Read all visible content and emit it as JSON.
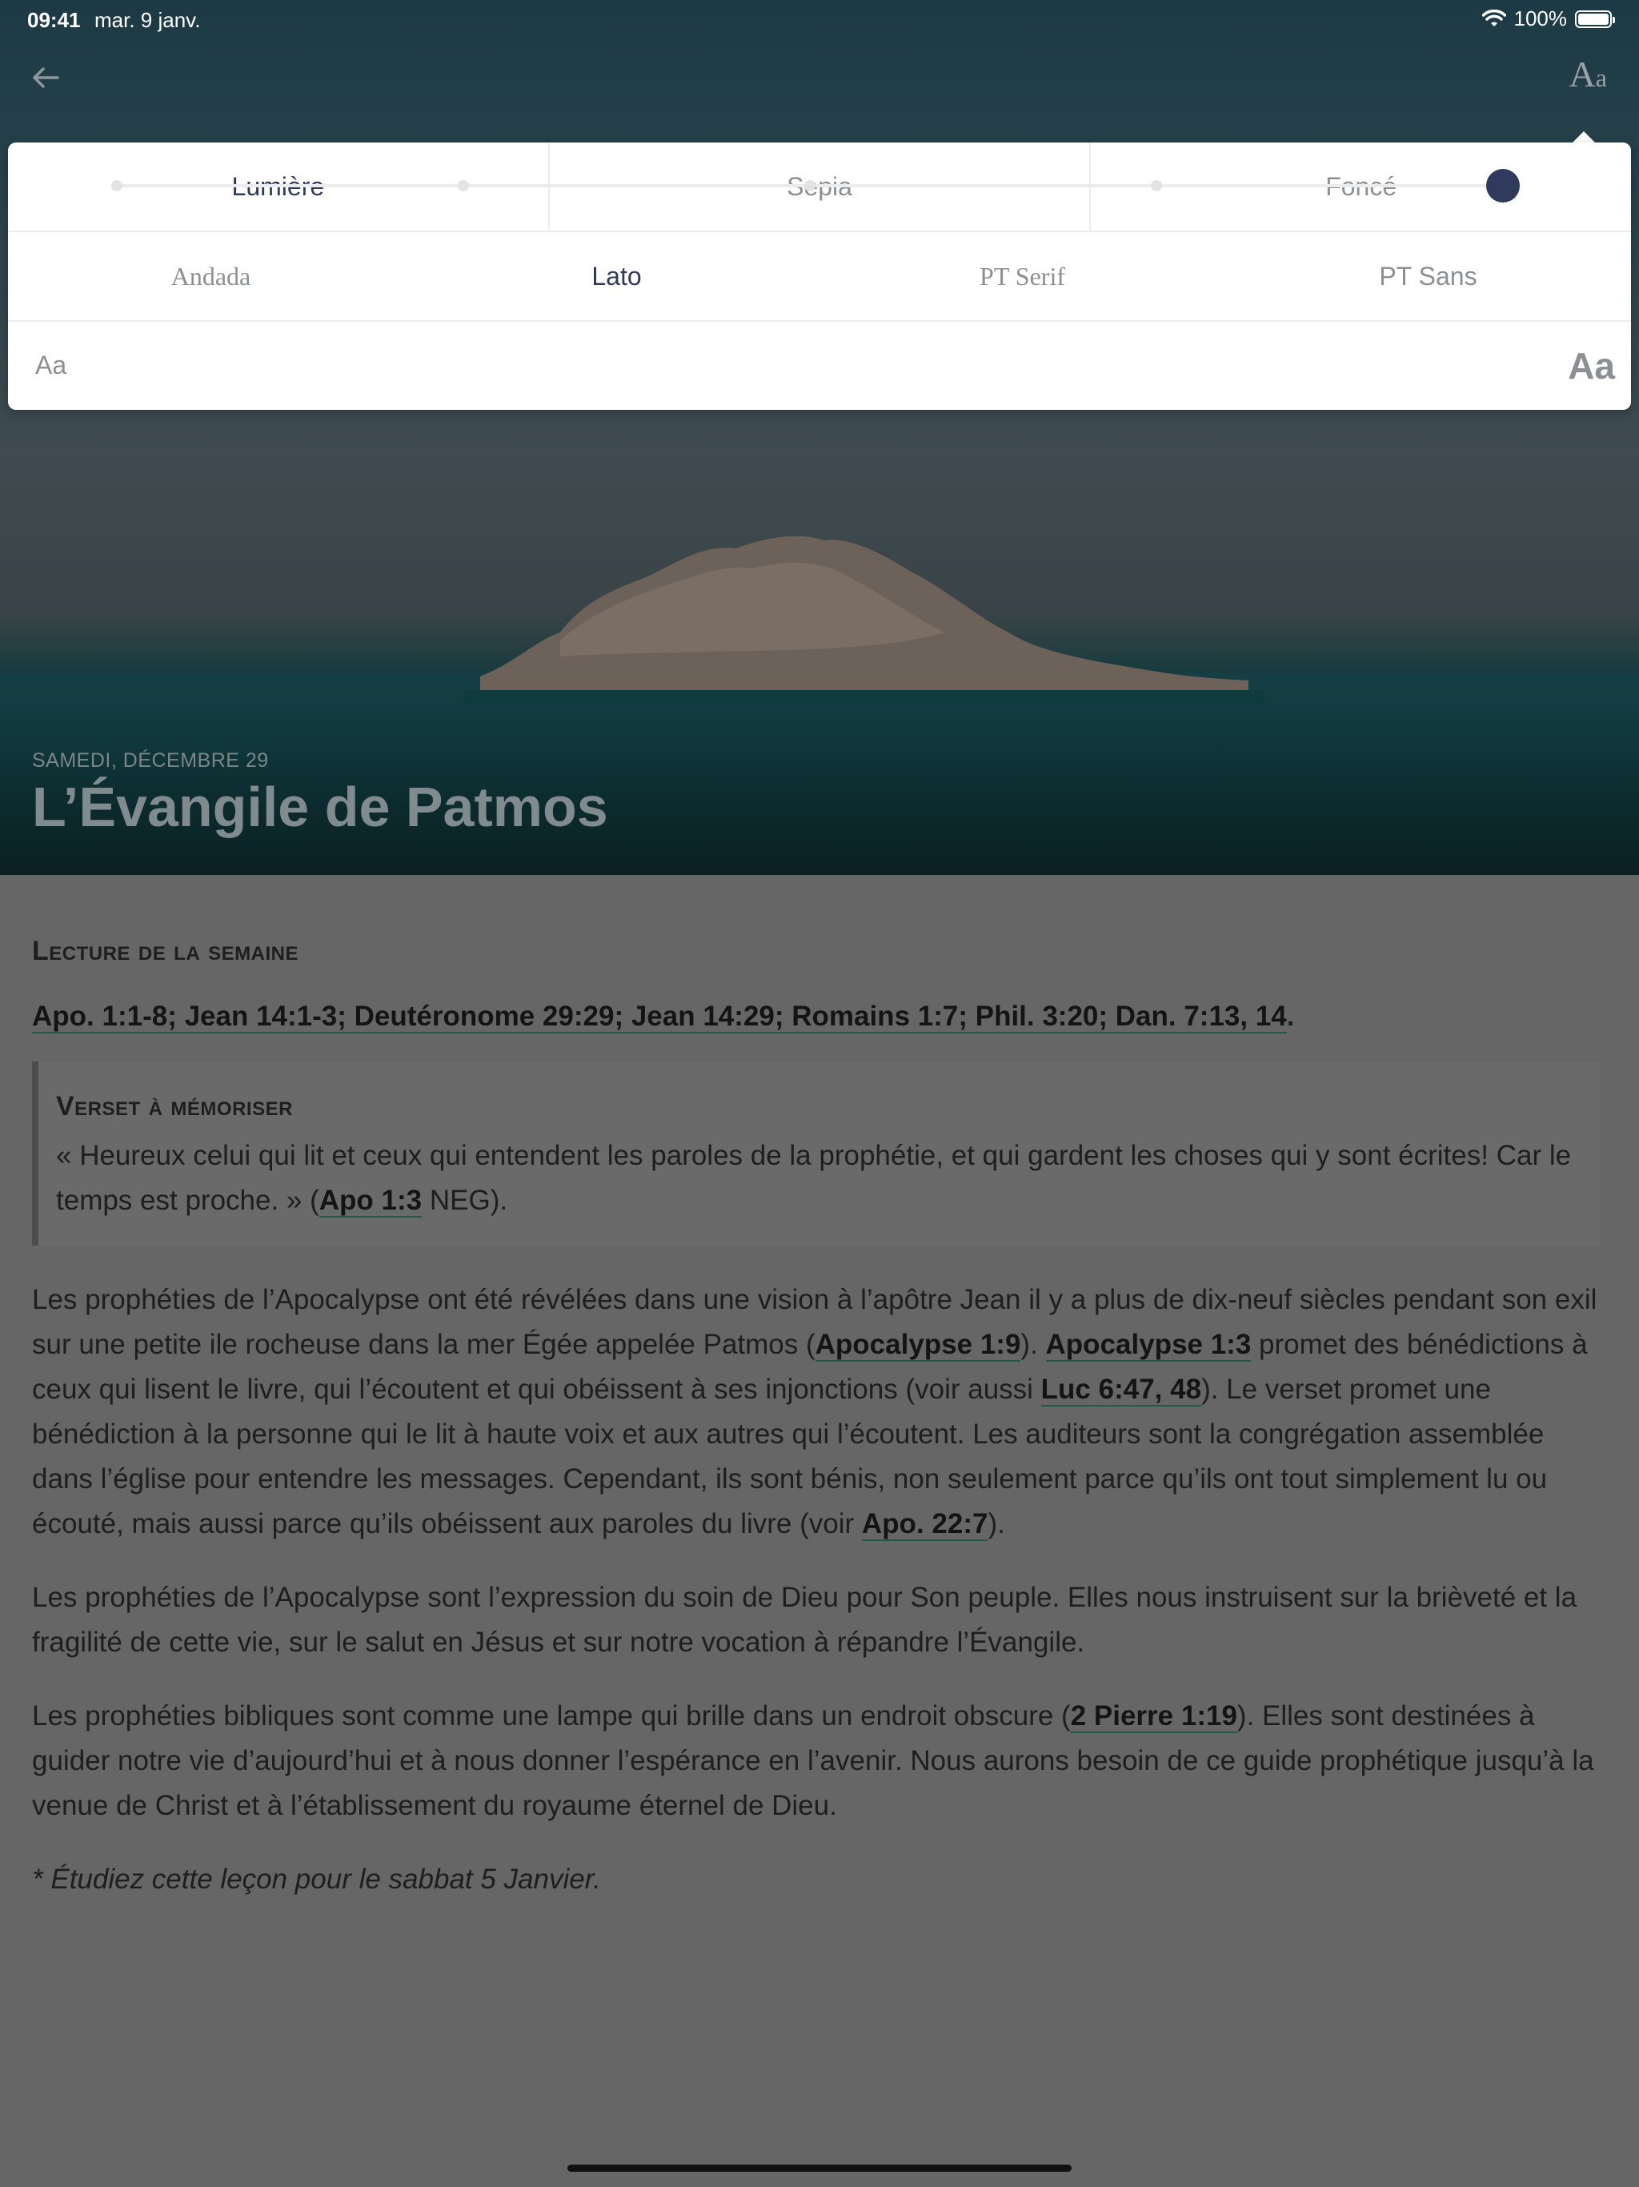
{
  "status_bar": {
    "time": "09:41",
    "date": "mar. 9 janv.",
    "battery": "100%",
    "wifi_icon": "wifi-icon",
    "battery_icon": "battery-icon"
  },
  "nav": {
    "back_icon": "arrow-left-icon",
    "font_toggle_big": "A",
    "font_toggle_small": "a"
  },
  "settings": {
    "themes": [
      {
        "label": "Lumière",
        "active": true
      },
      {
        "label": "Sepia",
        "active": false
      },
      {
        "label": "Foncé",
        "active": false
      }
    ],
    "fonts": [
      {
        "label": "Andada",
        "active": false
      },
      {
        "label": "Lato",
        "active": true
      },
      {
        "label": "PT Serif",
        "active": false
      },
      {
        "label": "PT Sans",
        "active": false
      }
    ],
    "size_small_label": "Aa",
    "size_large_label": "Aa",
    "size_steps": 5,
    "size_selected_index": 4,
    "accent_color": "#2f3a5c"
  },
  "hero": {
    "date": "SAMEDI, DÉCEMBRE 29",
    "title": "L’Évangile de Patmos"
  },
  "content": {
    "weekly_heading": "Lecture de la semaine",
    "weekly_refs": [
      "Apo. 1:1-8; Jean 14:1-3; Deutéronome 29:29; Jean 14:29; Romains 1:7; Phil. 3:20; Dan. 7:13, 14"
    ],
    "weekly_end": ".",
    "memory_heading": "Verset à mémoriser",
    "memory_text": "« Heureux celui qui lit et ceux qui entendent les paroles de la prophétie, et qui gardent les choses qui y sont écrites! Car le temps est proche. » (",
    "memory_ref": "Apo 1:3",
    "memory_end": " NEG).",
    "p1_a": "Les prophéties de l’Apocalypse ont été révélées dans une vision à l’apôtre Jean il y a plus de dix-neuf siècles pendant son exil sur une petite ile rocheuse dans la mer Égée appelée Patmos (",
    "p1_ref1": "Apocalypse 1:9",
    "p1_b": "). ",
    "p1_ref2": "Apocalypse 1:3",
    "p1_c": " promet des bénédictions à ceux qui lisent le livre, qui l’écoutent et qui obéissent à ses injonctions (voir aussi ",
    "p1_ref3": "Luc 6:47, 48",
    "p1_d": "). Le verset promet une bénédiction à la personne qui le lit à haute voix et aux autres qui l’écoutent. Les auditeurs sont la congrégation assemblée dans l’église pour entendre les messages. Cependant, ils sont bénis, non seulement parce qu’ils ont tout simplement lu ou écouté, mais aussi parce qu’ils obéissent aux paroles du livre (voir ",
    "p1_ref4": "Apo. 22:7",
    "p1_e": ").",
    "p2": "Les prophéties de l’Apocalypse sont l’expression du soin de Dieu pour Son peuple. Elles nous instruisent sur la brièveté et la fragilité de cette vie, sur le salut en Jésus et sur notre vocation à répandre l’Évangile.",
    "p3_a": "Les prophéties bibliques sont comme une lampe qui brille dans un endroit obscure (",
    "p3_ref": "2 Pierre 1:19",
    "p3_b": "). Elles sont destinées à guider notre vie d’aujourd’hui et à nous donner l’espérance en l’avenir. Nous aurons besoin de ce guide prophétique jusqu’à la venue de Christ et à l’établissement du royaume éternel de Dieu.",
    "note": "* Étudiez cette leçon pour le sabbat 5 Janvier."
  }
}
